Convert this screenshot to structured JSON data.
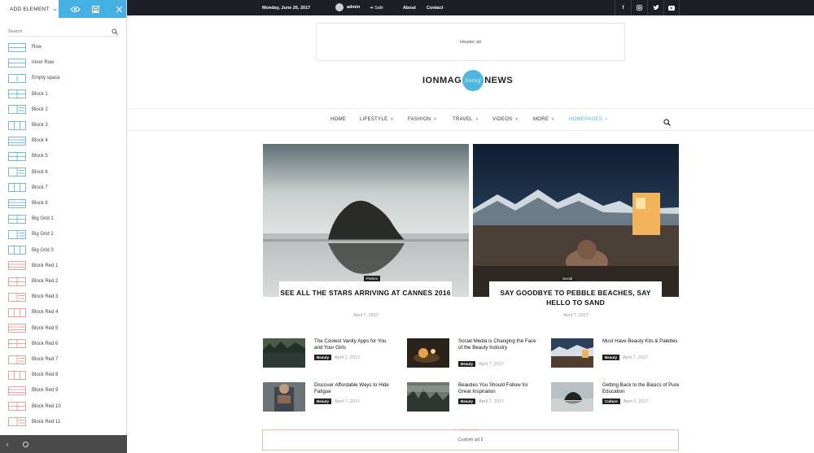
{
  "panel": {
    "add_element_label": "ADD ELEMENT",
    "search_placeholder": "Search",
    "items": [
      {
        "label": "Row",
        "color": "#5aa8d8"
      },
      {
        "label": "Inner Row",
        "color": "#5aa8d8"
      },
      {
        "label": "Empty space",
        "color": "#5aa8d8"
      },
      {
        "label": "Block 1",
        "color": "#5aa8d8"
      },
      {
        "label": "Block 2",
        "color": "#5aa8d8"
      },
      {
        "label": "Block 3",
        "color": "#5aa8d8"
      },
      {
        "label": "Block 4",
        "color": "#5aa8d8"
      },
      {
        "label": "Block 5",
        "color": "#5aa8d8"
      },
      {
        "label": "Block 6",
        "color": "#5aa8d8"
      },
      {
        "label": "Block 7",
        "color": "#5aa8d8"
      },
      {
        "label": "Block 8",
        "color": "#5aa8d8"
      },
      {
        "label": "Big Grid 1",
        "color": "#5aa8d8"
      },
      {
        "label": "Big Grid 2",
        "color": "#5aa8d8"
      },
      {
        "label": "Big Grid 3",
        "color": "#5aa8d8"
      },
      {
        "label": "Block Red 1",
        "color": "#e38a86"
      },
      {
        "label": "Block Red 2",
        "color": "#e38a86"
      },
      {
        "label": "Block Red 3",
        "color": "#e38a86"
      },
      {
        "label": "Block Red 4",
        "color": "#e38a86"
      },
      {
        "label": "Block Red 5",
        "color": "#e38a86"
      },
      {
        "label": "Block Red 6",
        "color": "#e38a86"
      },
      {
        "label": "Block Red 7",
        "color": "#e38a86"
      },
      {
        "label": "Block Red 8",
        "color": "#e38a86"
      },
      {
        "label": "Block Red 9",
        "color": "#e38a86"
      },
      {
        "label": "Block Red 10",
        "color": "#e38a86"
      },
      {
        "label": "Block Red 11",
        "color": "#e38a86"
      }
    ]
  },
  "topbar": {
    "date": "Monday, June 26, 2017",
    "user": "admin",
    "exit": "Salir",
    "about": "About",
    "contact": "Contact",
    "social_icons": [
      "facebook-icon",
      "instagram-icon",
      "twitter-icon",
      "youtube-icon"
    ]
  },
  "header_ad": "Header ad",
  "logo": {
    "left": "IONMAG",
    "circle": "living",
    "right": "NEWS",
    "accent": "#4db7e0"
  },
  "nav": {
    "items": [
      {
        "label": "HOME",
        "caret": false
      },
      {
        "label": "LIFESTYLE",
        "caret": true
      },
      {
        "label": "FASHION",
        "caret": true
      },
      {
        "label": "TRAVEL",
        "caret": true
      },
      {
        "label": "VIDEOS",
        "caret": true
      },
      {
        "label": "MORE",
        "caret": true
      },
      {
        "label": "HOMEPAGES",
        "caret": true,
        "active": true
      }
    ]
  },
  "featured": [
    {
      "category": "Parties",
      "title": "SEE ALL THE STARS ARRIVING AT CANNES 2016",
      "date": "April 7, 2017"
    },
    {
      "category": "Social",
      "title": "SAY GOODBYE TO PEBBLE BEACHES, SAY HELLO TO SAND",
      "date": "April 7, 2017"
    }
  ],
  "posts": [
    {
      "title": "The Coolest Vanity Apps for You and Your Girls",
      "badge": "Beauty",
      "date": "April 7, 2017"
    },
    {
      "title": "Social Media is Changing the Face of the Beauty Industry",
      "badge": "Beauty",
      "date": "April 7, 2017"
    },
    {
      "title": "Must Have Beauty Kits & Palettes",
      "badge": "Beauty",
      "date": "April 7, 2017"
    },
    {
      "title": "Discover Affordable Ways to Hide Fatigue",
      "badge": "Beauty",
      "date": "April 7, 2017"
    },
    {
      "title": "Beauties You Should Follow for Great Inspiration",
      "badge": "Beauty",
      "date": "April 7, 2017"
    },
    {
      "title": "Getting Back to the Basics of Pure Education",
      "badge": "Culture",
      "date": "April 7, 2017"
    }
  ],
  "empty_space_label": "Empty space",
  "custom_ad": "Custom ad 2"
}
